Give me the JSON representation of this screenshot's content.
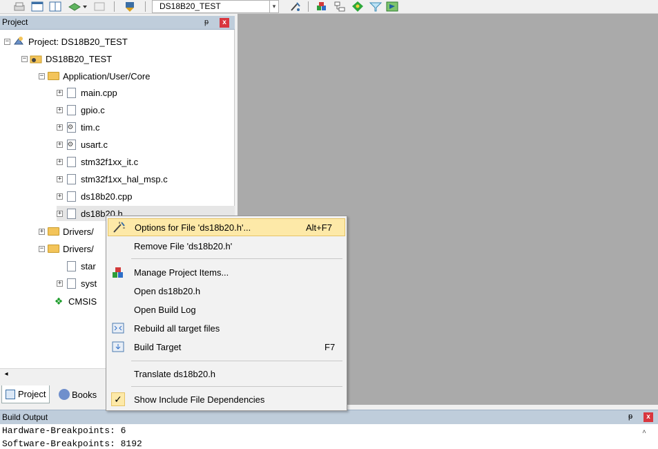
{
  "toolbar": {
    "target_name": "DS18B20_TEST"
  },
  "project_panel": {
    "title": "Project",
    "tree": [
      {
        "label": "Project: DS18B20_TEST"
      },
      {
        "label": "DS18B20_TEST"
      },
      {
        "label": "Application/User/Core"
      },
      {
        "label": "main.cpp"
      },
      {
        "label": "gpio.c"
      },
      {
        "label": "tim.c"
      },
      {
        "label": "usart.c"
      },
      {
        "label": "stm32f1xx_it.c"
      },
      {
        "label": "stm32f1xx_hal_msp.c"
      },
      {
        "label": "ds18b20.cpp"
      },
      {
        "label": "ds18b20.h"
      },
      {
        "label": "Drivers/"
      },
      {
        "label": "Drivers/"
      },
      {
        "label": "star"
      },
      {
        "label": "syst"
      },
      {
        "label": "CMSIS"
      }
    ],
    "tabs": [
      {
        "label": "Project"
      },
      {
        "label": "Books"
      }
    ]
  },
  "context_menu": {
    "items": [
      {
        "label": "Options for File 'ds18b20.h'...",
        "shortcut": "Alt+F7"
      },
      {
        "label": "Remove File 'ds18b20.h'",
        "shortcut": ""
      },
      {
        "label": "Manage Project Items...",
        "shortcut": ""
      },
      {
        "label": "Open ds18b20.h",
        "shortcut": ""
      },
      {
        "label": "Open Build Log",
        "shortcut": ""
      },
      {
        "label": "Rebuild all target files",
        "shortcut": ""
      },
      {
        "label": "Build Target",
        "shortcut": "F7"
      },
      {
        "label": "Translate ds18b20.h",
        "shortcut": ""
      },
      {
        "label": "Show Include File Dependencies",
        "shortcut": ""
      }
    ],
    "check_mark": "✓"
  },
  "build_output": {
    "title": "Build Output",
    "lines": [
      "Hardware-Breakpoints: 6",
      "Software-Breakpoints: 8192"
    ]
  },
  "icons": {
    "pin": "ᵽ",
    "close": "x",
    "scroll_left": "◂",
    "scroll_up": "^"
  },
  "colors": {
    "highlight": "#fde9a8",
    "panel_header": "#bfcddb",
    "editor_bg": "#aaaaaa"
  }
}
